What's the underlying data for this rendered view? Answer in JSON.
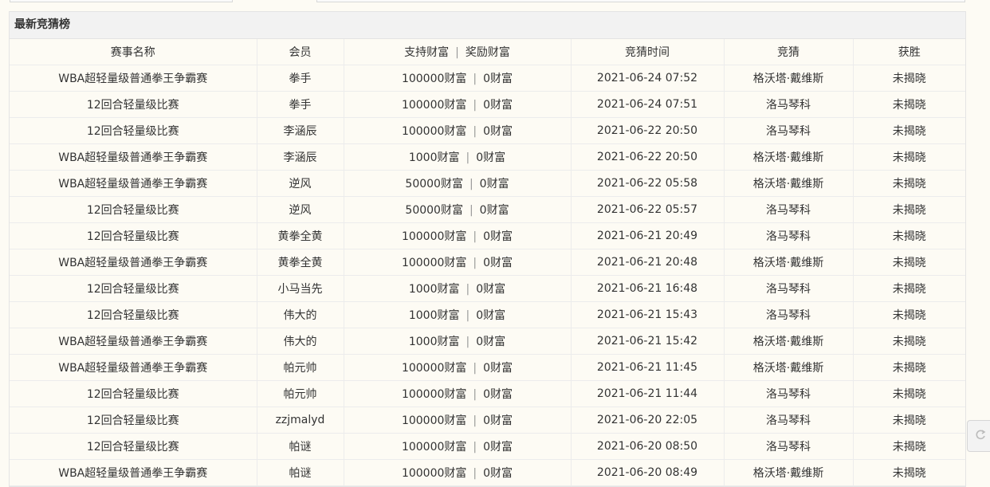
{
  "panel": {
    "title": "最新竞猜榜"
  },
  "columns": {
    "event": "赛事名称",
    "member": "会员",
    "support": "支持财富",
    "reward": "奖励财富",
    "time": "竞猜时间",
    "guess": "竞猜",
    "winner": "获胜"
  },
  "separator": "|",
  "rows": [
    {
      "event": "WBA超轻量级普通拳王争霸赛",
      "member": "拳手",
      "support": "100000财富",
      "reward": "0财富",
      "time": "2021-06-24 07:52",
      "guess": "格沃塔·戴维斯",
      "winner": "未揭晓"
    },
    {
      "event": "12回合轻量级比赛",
      "member": "拳手",
      "support": "100000财富",
      "reward": "0财富",
      "time": "2021-06-24 07:51",
      "guess": "洛马琴科",
      "winner": "未揭晓"
    },
    {
      "event": "12回合轻量级比赛",
      "member": "李涵辰",
      "support": "100000财富",
      "reward": "0财富",
      "time": "2021-06-22 20:50",
      "guess": "洛马琴科",
      "winner": "未揭晓"
    },
    {
      "event": "WBA超轻量级普通拳王争霸赛",
      "member": "李涵辰",
      "support": "1000财富",
      "reward": "0财富",
      "time": "2021-06-22 20:50",
      "guess": "格沃塔·戴维斯",
      "winner": "未揭晓"
    },
    {
      "event": "WBA超轻量级普通拳王争霸赛",
      "member": "逆风",
      "support": "50000财富",
      "reward": "0财富",
      "time": "2021-06-22 05:58",
      "guess": "格沃塔·戴维斯",
      "winner": "未揭晓"
    },
    {
      "event": "12回合轻量级比赛",
      "member": "逆风",
      "support": "50000财富",
      "reward": "0财富",
      "time": "2021-06-22 05:57",
      "guess": "洛马琴科",
      "winner": "未揭晓"
    },
    {
      "event": "12回合轻量级比赛",
      "member": "黄拳全黄",
      "support": "100000财富",
      "reward": "0财富",
      "time": "2021-06-21 20:49",
      "guess": "洛马琴科",
      "winner": "未揭晓"
    },
    {
      "event": "WBA超轻量级普通拳王争霸赛",
      "member": "黄拳全黄",
      "support": "100000财富",
      "reward": "0财富",
      "time": "2021-06-21 20:48",
      "guess": "格沃塔·戴维斯",
      "winner": "未揭晓"
    },
    {
      "event": "12回合轻量级比赛",
      "member": "小马当先",
      "support": "1000财富",
      "reward": "0财富",
      "time": "2021-06-21 16:48",
      "guess": "洛马琴科",
      "winner": "未揭晓"
    },
    {
      "event": "12回合轻量级比赛",
      "member": "伟大的",
      "support": "1000财富",
      "reward": "0财富",
      "time": "2021-06-21 15:43",
      "guess": "洛马琴科",
      "winner": "未揭晓"
    },
    {
      "event": "WBA超轻量级普通拳王争霸赛",
      "member": "伟大的",
      "support": "1000财富",
      "reward": "0财富",
      "time": "2021-06-21 15:42",
      "guess": "格沃塔·戴维斯",
      "winner": "未揭晓"
    },
    {
      "event": "WBA超轻量级普通拳王争霸赛",
      "member": "帕元帅",
      "support": "100000财富",
      "reward": "0财富",
      "time": "2021-06-21 11:45",
      "guess": "格沃塔·戴维斯",
      "winner": "未揭晓"
    },
    {
      "event": "12回合轻量级比赛",
      "member": "帕元帅",
      "support": "100000财富",
      "reward": "0财富",
      "time": "2021-06-21 11:44",
      "guess": "洛马琴科",
      "winner": "未揭晓"
    },
    {
      "event": "12回合轻量级比赛",
      "member": "zzjmalyd",
      "support": "100000财富",
      "reward": "0财富",
      "time": "2021-06-20 22:05",
      "guess": "洛马琴科",
      "winner": "未揭晓"
    },
    {
      "event": "12回合轻量级比赛",
      "member": "帕谜",
      "support": "100000财富",
      "reward": "0财富",
      "time": "2021-06-20 08:50",
      "guess": "洛马琴科",
      "winner": "未揭晓"
    },
    {
      "event": "WBA超轻量级普通拳王争霸赛",
      "member": "帕谜",
      "support": "100000财富",
      "reward": "0财富",
      "time": "2021-06-20 08:49",
      "guess": "格沃塔·戴维斯",
      "winner": "未揭晓"
    }
  ],
  "icons": {
    "scroll_widget": "refresh-icon"
  }
}
